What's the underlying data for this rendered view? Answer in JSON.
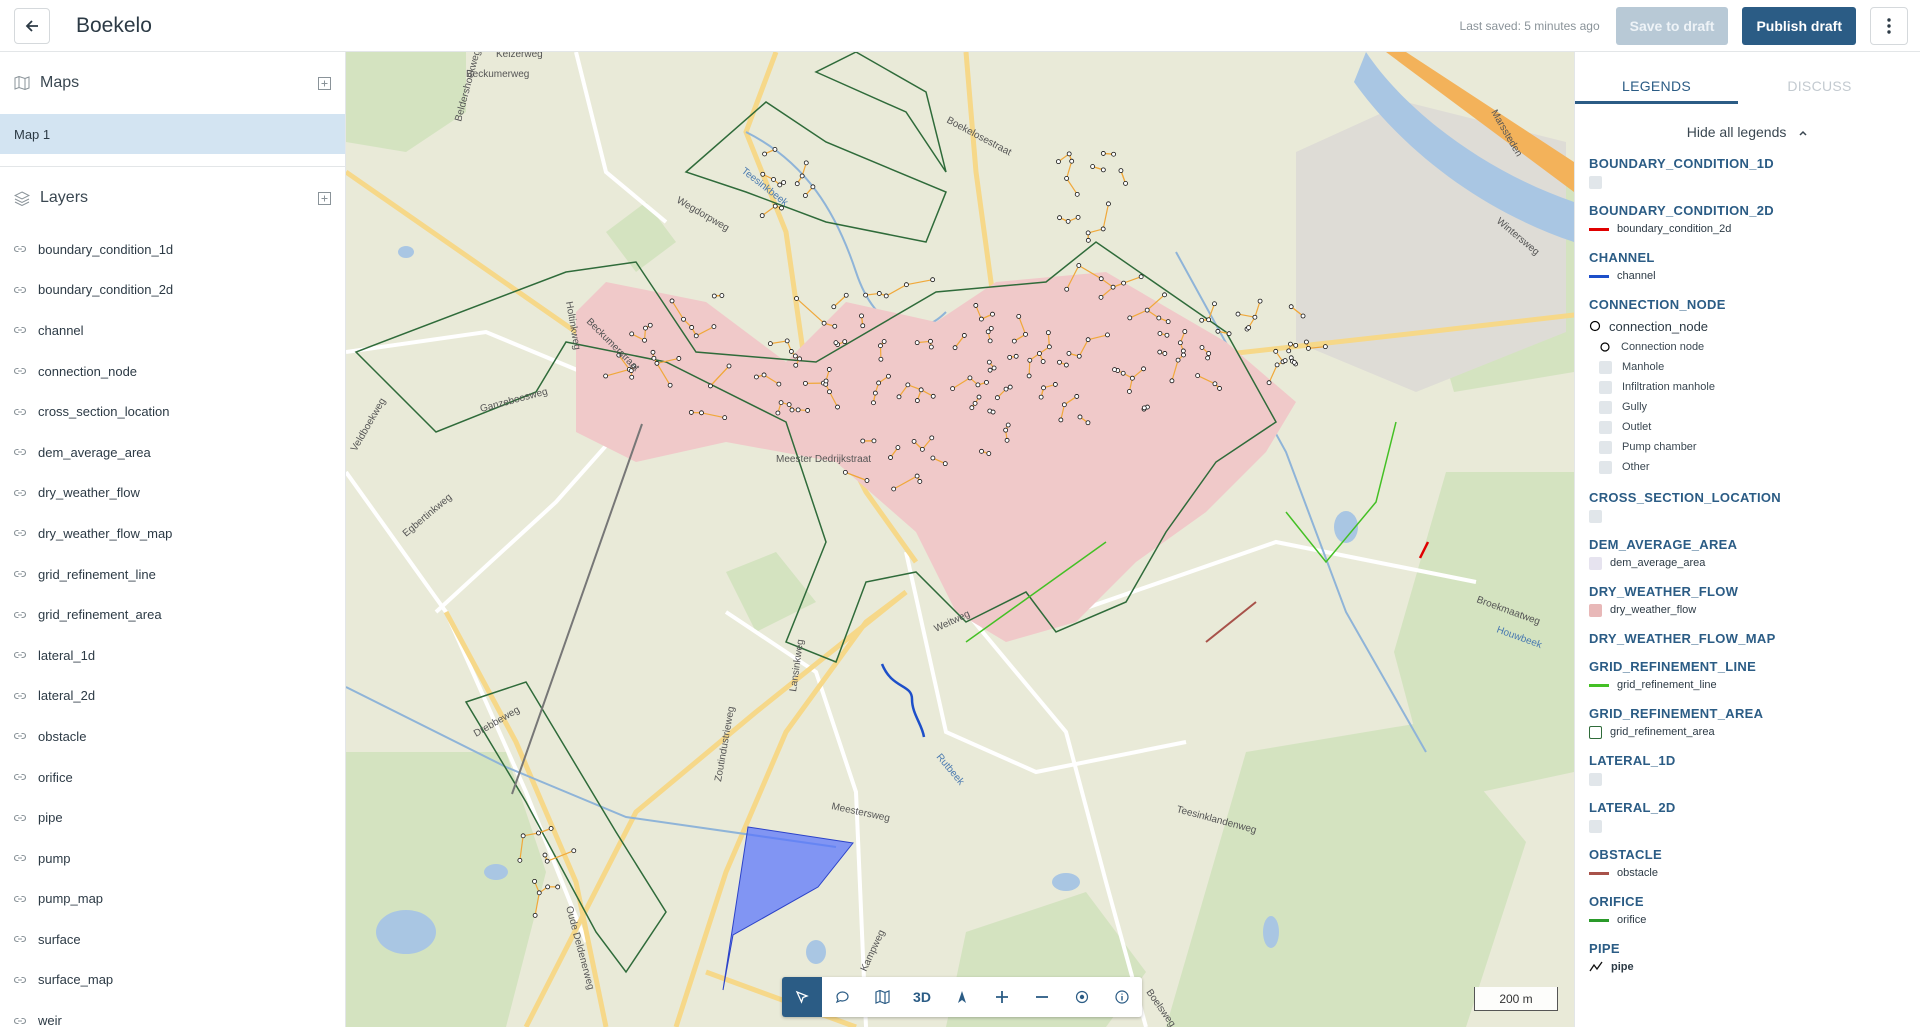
{
  "header": {
    "title": "Boekelo",
    "last_saved": "Last saved: 5 minutes ago",
    "save_draft_label": "Save to draft",
    "publish_label": "Publish draft"
  },
  "sidebar": {
    "maps_title": "Maps",
    "maps": [
      {
        "label": "Map 1"
      }
    ],
    "layers_title": "Layers",
    "layers": [
      {
        "label": "boundary_condition_1d"
      },
      {
        "label": "boundary_condition_2d"
      },
      {
        "label": "channel"
      },
      {
        "label": "connection_node"
      },
      {
        "label": "cross_section_location"
      },
      {
        "label": "dem_average_area"
      },
      {
        "label": "dry_weather_flow"
      },
      {
        "label": "dry_weather_flow_map"
      },
      {
        "label": "grid_refinement_line"
      },
      {
        "label": "grid_refinement_area"
      },
      {
        "label": "lateral_1d"
      },
      {
        "label": "lateral_2d"
      },
      {
        "label": "obstacle"
      },
      {
        "label": "orifice"
      },
      {
        "label": "pipe"
      },
      {
        "label": "pump"
      },
      {
        "label": "pump_map"
      },
      {
        "label": "surface"
      },
      {
        "label": "surface_map"
      },
      {
        "label": "weir"
      }
    ]
  },
  "map": {
    "street_labels": [
      "Beckumerweg",
      "Keizerweg",
      "Beldershoekweg",
      "Teesinkbeek",
      "Wegdorpweg",
      "Boekelosestraat",
      "Ganzeboosweg",
      "Veldboekweg",
      "Egbertinkweg",
      "Holtinkweg",
      "Beckumerstraat",
      "Meester Dedrijkstraat",
      "Weitweg",
      "Lansinkweg",
      "Zoutindustrieweg",
      "Meestersweg",
      "Drebbeweg",
      "Oude Deldenerweg",
      "Rutbeek",
      "Kampweg",
      "Teesinklandenweg",
      "Broekmaatweg",
      "Houwbeek",
      "Marssteden",
      "Wintersweg",
      "Boelsweg"
    ],
    "scale_label": "200 m",
    "tools": [
      {
        "name": "select-tool",
        "icon": "cursor-arrow",
        "label": ""
      },
      {
        "name": "comment-tool",
        "icon": "chat-bubble",
        "label": ""
      },
      {
        "name": "map-tool",
        "icon": "map",
        "label": ""
      },
      {
        "name": "3d-tool",
        "icon": "",
        "label": "3D"
      },
      {
        "name": "north-tool",
        "icon": "compass-north",
        "label": ""
      },
      {
        "name": "zoom-in-tool",
        "icon": "plus",
        "label": ""
      },
      {
        "name": "zoom-out-tool",
        "icon": "minus",
        "label": ""
      },
      {
        "name": "locate-tool",
        "icon": "target",
        "label": ""
      },
      {
        "name": "info-tool",
        "icon": "info",
        "label": ""
      }
    ]
  },
  "rightpanel": {
    "tabs": [
      {
        "label": "LEGENDS"
      },
      {
        "label": "DISCUSS"
      }
    ],
    "hide_legends": "Hide all legends",
    "legends": [
      {
        "title": "BOUNDARY_CONDITION_1D",
        "items": [
          {
            "label": "",
            "kind": "box",
            "color": "#e1e6ea"
          }
        ]
      },
      {
        "title": "BOUNDARY_CONDITION_2D",
        "items": [
          {
            "label": "boundary_condition_2d",
            "kind": "line",
            "color": "#e00000"
          }
        ]
      },
      {
        "title": "CHANNEL",
        "items": [
          {
            "label": "channel",
            "kind": "line",
            "color": "#1d4fc9"
          }
        ]
      },
      {
        "title": "CONNECTION_NODE",
        "items": [
          {
            "label": "connection_node",
            "kind": "circle",
            "color": "#000000",
            "big": true
          },
          {
            "label": "Connection node",
            "kind": "circle",
            "color": "#000000",
            "indent": true
          },
          {
            "label": "Manhole",
            "kind": "box",
            "color": "#e1e6ea",
            "indent": true
          },
          {
            "label": "Infiltration manhole",
            "kind": "box",
            "color": "#e1e6ea",
            "indent": true
          },
          {
            "label": "Gully",
            "kind": "box",
            "color": "#e1e6ea",
            "indent": true
          },
          {
            "label": "Outlet",
            "kind": "box",
            "color": "#e1e6ea",
            "indent": true
          },
          {
            "label": "Pump chamber",
            "kind": "box",
            "color": "#e1e6ea",
            "indent": true
          },
          {
            "label": "Other",
            "kind": "box",
            "color": "#e1e6ea",
            "indent": true
          }
        ]
      },
      {
        "title": "CROSS_SECTION_LOCATION",
        "items": [
          {
            "label": "",
            "kind": "box",
            "color": "#e1e6ea"
          }
        ]
      },
      {
        "title": "DEM_AVERAGE_AREA",
        "items": [
          {
            "label": "dem_average_area",
            "kind": "box",
            "color": "#e6e3ef"
          }
        ]
      },
      {
        "title": "DRY_WEATHER_FLOW",
        "items": [
          {
            "label": "dry_weather_flow",
            "kind": "box",
            "color": "#e8b8b8"
          }
        ]
      },
      {
        "title": "DRY_WEATHER_FLOW_MAP",
        "items": []
      },
      {
        "title": "GRID_REFINEMENT_LINE",
        "items": [
          {
            "label": "grid_refinement_line",
            "kind": "line",
            "color": "#44c025"
          }
        ]
      },
      {
        "title": "GRID_REFINEMENT_AREA",
        "items": [
          {
            "label": "grid_refinement_area",
            "kind": "outline",
            "color": "#2f6b3a"
          }
        ]
      },
      {
        "title": "LATERAL_1D",
        "items": [
          {
            "label": "",
            "kind": "box",
            "color": "#e1e6ea"
          }
        ]
      },
      {
        "title": "LATERAL_2D",
        "items": [
          {
            "label": "",
            "kind": "box",
            "color": "#e1e6ea"
          }
        ]
      },
      {
        "title": "OBSTACLE",
        "items": [
          {
            "label": "obstacle",
            "kind": "line",
            "color": "#a8524a"
          }
        ]
      },
      {
        "title": "ORIFICE",
        "items": [
          {
            "label": "orifice",
            "kind": "line",
            "color": "#2a9a2a"
          }
        ]
      },
      {
        "title": "PIPE",
        "items": [
          {
            "label": "pipe",
            "kind": "zigzag",
            "color": "#111111"
          }
        ]
      }
    ]
  }
}
